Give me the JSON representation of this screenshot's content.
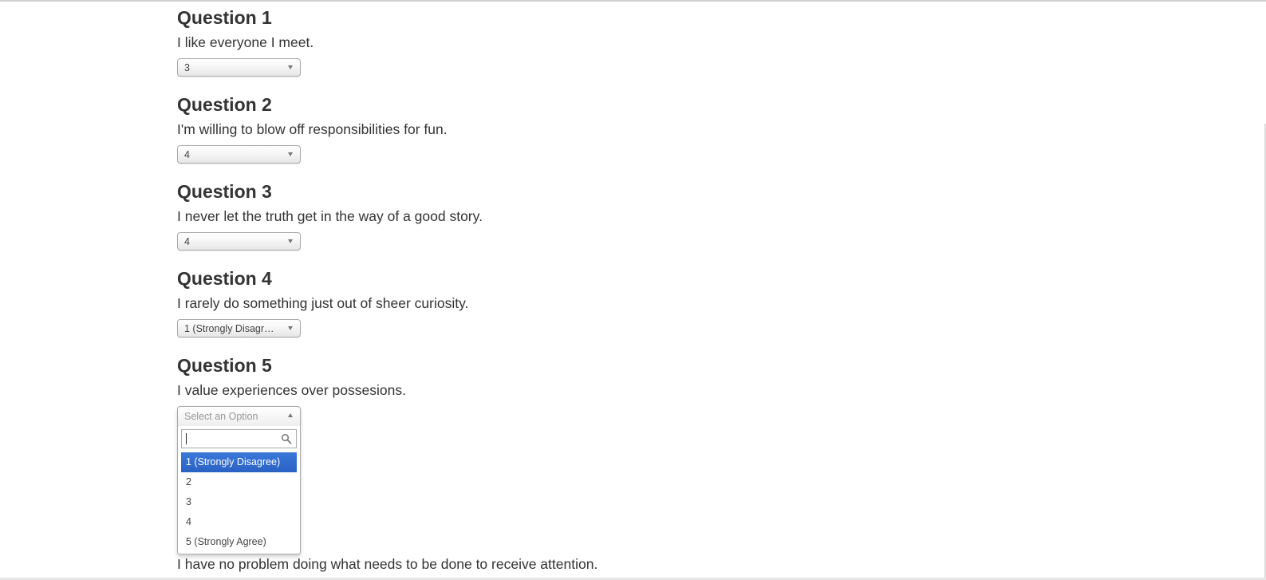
{
  "questions": [
    {
      "title": "Question 1",
      "text": "I like everyone I meet.",
      "selected": "3"
    },
    {
      "title": "Question 2",
      "text": "I'm willing to blow off responsibilities for fun.",
      "selected": "4"
    },
    {
      "title": "Question 3",
      "text": "I never let the truth get in the way of a good story.",
      "selected": "4"
    },
    {
      "title": "Question 4",
      "text": "I rarely do something just out of sheer curiosity.",
      "selected": "1 (Strongly Disagree)"
    },
    {
      "title": "Question 5",
      "text": "I value experiences over possesions.",
      "placeholder": "Select an Option",
      "search_value": ""
    }
  ],
  "options": [
    "1 (Strongly Disagree)",
    "2",
    "3",
    "4",
    "5 (Strongly Agree)"
  ],
  "highlighted_option": "1 (Strongly Disagree)",
  "question6_text": "I have no problem doing what needs to be done to receive attention.",
  "colors": {
    "text": "#333333",
    "highlight": "#3a78d8",
    "border": "#aaaaaa"
  },
  "icons": {
    "search": "search-icon",
    "dropdown": "chevron-down-icon",
    "dropup": "chevron-up-icon"
  }
}
